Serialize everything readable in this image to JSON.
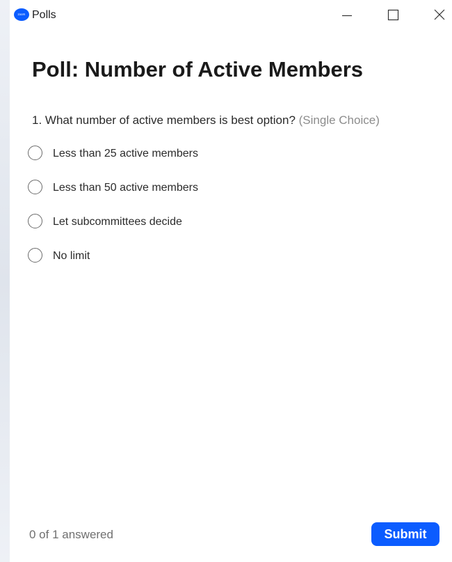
{
  "window": {
    "app_logo_text": "zoom",
    "title": "Polls",
    "controls": {
      "minimize_icon": "minimize-icon",
      "maximize_icon": "maximize-icon",
      "close_icon": "close-icon"
    }
  },
  "poll": {
    "title": "Poll: Number of Active Members",
    "question": {
      "text": "1. What number of active members is best option?",
      "type": "(Single Choice)",
      "options": [
        {
          "label": "Less than 25 active members",
          "selected": false
        },
        {
          "label": "Less than 50 active members",
          "selected": false
        },
        {
          "label": "Let subcommittees decide",
          "selected": false
        },
        {
          "label": "No limit",
          "selected": false
        }
      ]
    }
  },
  "footer": {
    "progress": "0 of 1 answered",
    "submit_label": "Submit"
  },
  "colors": {
    "accent": "#0b5cff",
    "text": "#1a1a1a",
    "muted": "#8c8c8c",
    "background": "#ffffff"
  }
}
